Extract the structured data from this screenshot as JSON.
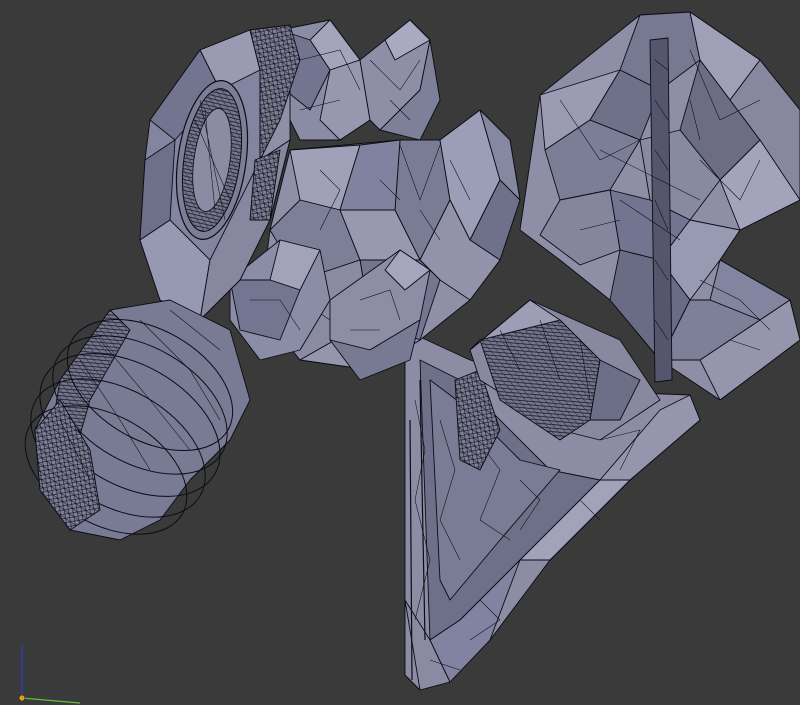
{
  "viewport": {
    "mode": "edit-mode-wireframe-mesh",
    "background_color": "#3a3a3a",
    "mesh_face_color": "#8d8ea6",
    "mesh_edge_color": "#0c0c14"
  },
  "axis_gizmo": {
    "x_axis_color": "#5fbf3b",
    "y_axis_color": "#2f3fd0",
    "origin_color": "#d8a020"
  }
}
